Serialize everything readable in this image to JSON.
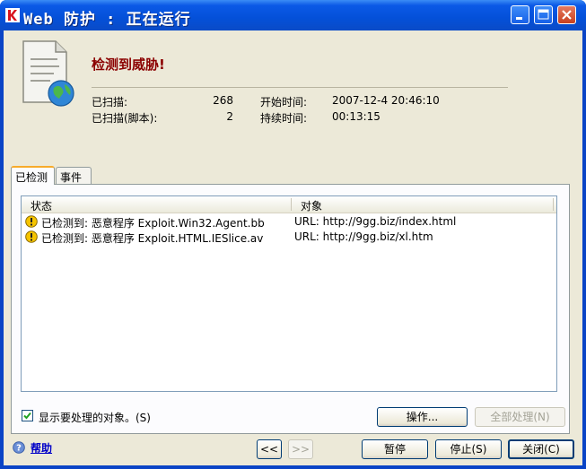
{
  "window": {
    "title": "Web 防护 : 正在运行"
  },
  "header": {
    "headline": "检测到威胁!",
    "scanned_label": "已扫描:",
    "scanned_value": "268",
    "scanned_scripts_label": "已扫描(脚本):",
    "scanned_scripts_value": "2",
    "start_time_label": "开始时间:",
    "start_time_value": "2007-12-4 20:46:10",
    "duration_label": "持续时间:",
    "duration_value": "00:13:15"
  },
  "tabs": [
    {
      "label": "已检测",
      "active": true
    },
    {
      "label": "事件",
      "active": false
    }
  ],
  "table": {
    "columns": [
      "状态",
      "对象"
    ],
    "rows": [
      {
        "status": "已检测到: 恶意程序 Exploit.Win32.Agent.bb",
        "object": "URL: http://9gg.biz/index.html"
      },
      {
        "status": "已检测到: 恶意程序 Exploit.HTML.IESlice.av",
        "object": "URL: http://9gg.biz/xl.htm"
      }
    ]
  },
  "options": {
    "show_objects_label": "显示要处理的对象。(S)",
    "show_objects_checked": true
  },
  "buttons": {
    "actions": "操作...",
    "process_all": "全部处理(N)",
    "prev": "<<",
    "next": ">>",
    "pause": "暂停",
    "stop": "停止(S)",
    "close": "关闭(C)",
    "help": "帮助"
  },
  "colors": {
    "title_bar": "#0450d8",
    "headline": "#8b0000",
    "dialog_bg": "#ece9d8",
    "warning": "#f5c400"
  }
}
